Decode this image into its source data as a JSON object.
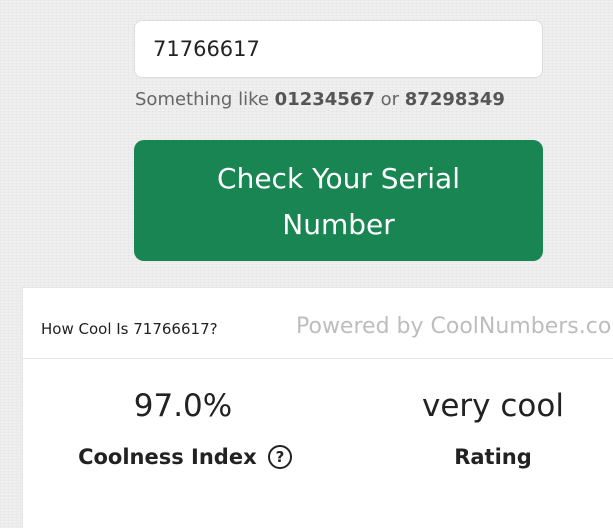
{
  "search": {
    "value": "71766617",
    "hint_prefix": "Something like",
    "example_one": "01234567",
    "hint_or": "or",
    "example_two": "87298349"
  },
  "check_button": {
    "label": "Check Your Serial Number"
  },
  "result": {
    "title": "How Cool Is 71766617?",
    "powered_by": "Powered by CoolNumbers.co",
    "coolness_index": {
      "value": "97.0%",
      "label": "Coolness Index",
      "help_icon": "?"
    },
    "rating": {
      "value": "very cool",
      "label": "Rating"
    }
  },
  "colors": {
    "button_green": "#198553",
    "background": "#efefef",
    "card": "#ffffff",
    "muted_text": "#bdbdbd"
  },
  "icons": {
    "help": "question-circle-icon"
  }
}
